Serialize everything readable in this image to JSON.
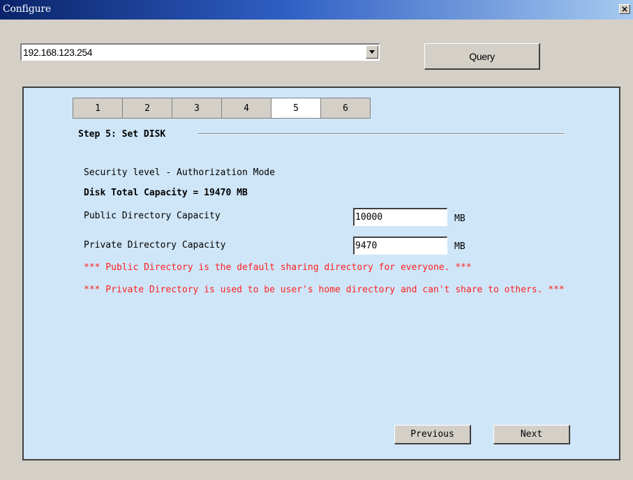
{
  "window": {
    "title": "Configure",
    "close_label": "×"
  },
  "toolbar": {
    "ip_value": "192.168.123.254",
    "query_label": "Query"
  },
  "tabs": [
    {
      "label": "1"
    },
    {
      "label": "2"
    },
    {
      "label": "3"
    },
    {
      "label": "4"
    },
    {
      "label": "5",
      "active": true
    },
    {
      "label": "6"
    }
  ],
  "step": {
    "title": "Step 5: Set DISK",
    "security_level": "Security level - Authorization Mode",
    "disk_total": "Disk Total Capacity = 19470 MB",
    "public_label": "Public Directory Capacity",
    "public_value": "10000",
    "public_unit": "MB",
    "private_label": "Private Directory Capacity",
    "private_value": "9470",
    "private_unit": "MB",
    "note_public": "*** Public Directory is the default sharing directory for everyone. ***",
    "note_private": "*** Private Directory is used to be user's home directory and can't share to others. ***"
  },
  "nav": {
    "previous_label": "Previous",
    "next_label": "Next"
  },
  "colors": {
    "panel_bg": "#cfe6f8",
    "note_text": "#ff0000",
    "title_bar": "#0a246a"
  }
}
